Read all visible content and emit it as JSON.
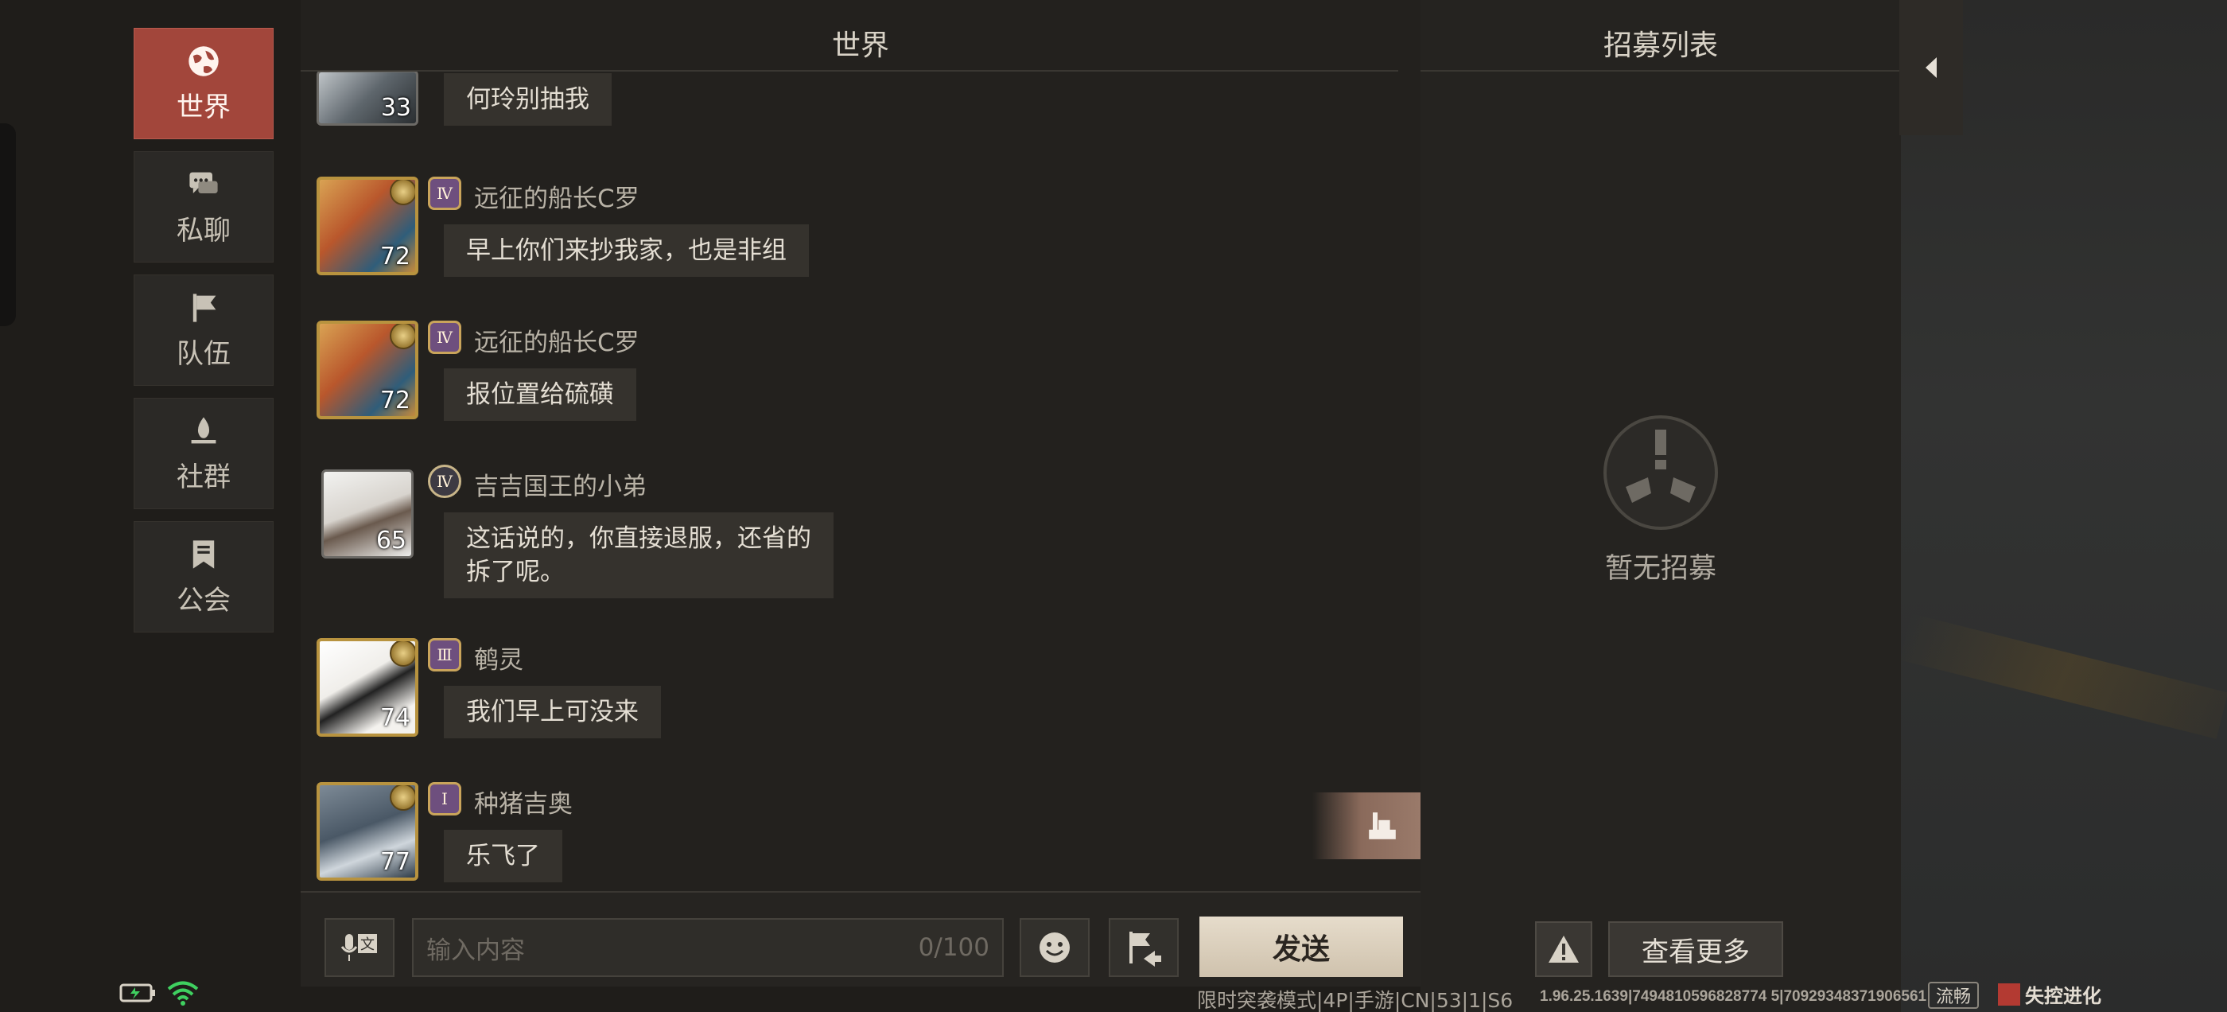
{
  "nav": {
    "items": [
      {
        "label": "世界",
        "icon": "globe-icon",
        "active": true
      },
      {
        "label": "私聊",
        "icon": "chat-bubbles-icon",
        "active": false
      },
      {
        "label": "队伍",
        "icon": "flag-icon",
        "active": false
      },
      {
        "label": "社群",
        "icon": "campfire-icon",
        "active": false
      },
      {
        "label": "公会",
        "icon": "banner-icon",
        "active": false
      }
    ]
  },
  "chat": {
    "title": "世界",
    "messages": [
      {
        "level": "33",
        "rank": "",
        "name": "",
        "text": "何玲别抽我"
      },
      {
        "level": "72",
        "rank": "Ⅳ",
        "name": "远征的船长C罗",
        "text": "早上你们来抄我家，也是非组"
      },
      {
        "level": "72",
        "rank": "Ⅳ",
        "name": "远征的船长C罗",
        "text": "报位置给硫磺"
      },
      {
        "level": "65",
        "rank": "Ⅳ",
        "name": "吉吉国王的小弟",
        "text_line1": "这话说的，你直接退服，还省的",
        "text_line2": "拆了呢。"
      },
      {
        "level": "74",
        "rank": "Ⅲ",
        "name": "鹌灵",
        "text": "我们早上可没来"
      },
      {
        "level": "77",
        "rank": "Ⅰ",
        "name": "种猪吉奥",
        "text": "乐飞了"
      }
    ]
  },
  "input": {
    "voice_label": "文",
    "placeholder": "输入内容",
    "counter": "0/100",
    "send_label": "发送"
  },
  "recruit": {
    "title": "招募列表",
    "empty_text": "暂无招募",
    "more_label": "查看更多"
  },
  "footer": {
    "mode_info": "限时突袭模式|4P|手游|CN|53|1|S6",
    "build_info": "1.96.25.1639|7494810596828774 5|70929348371906561",
    "smooth_label": "流畅",
    "logo_text": "失控进化"
  },
  "colors": {
    "nav_active": "#a2463b",
    "send_button": "#e6dccb",
    "background": "#1f1d1a"
  }
}
